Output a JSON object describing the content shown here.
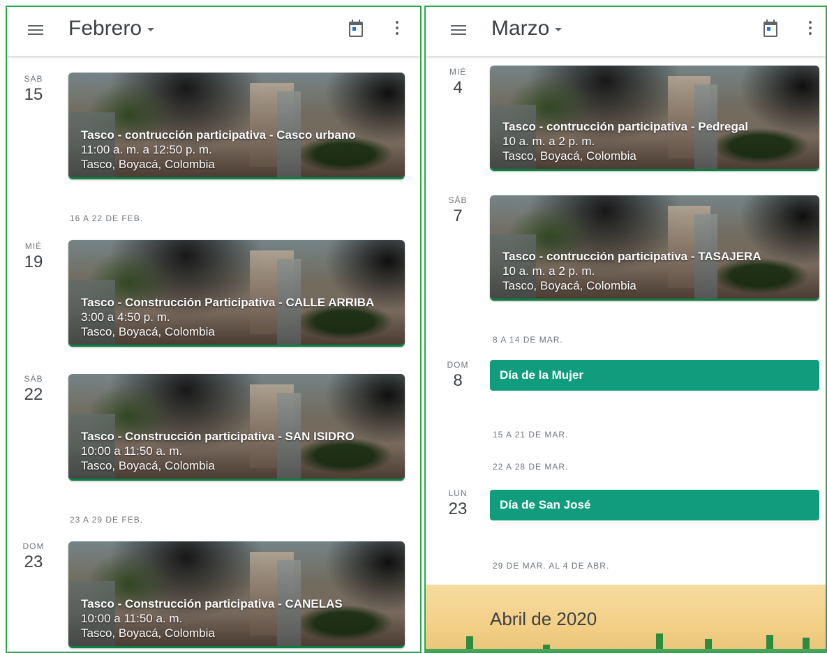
{
  "left": {
    "header": {
      "title": "Febrero"
    },
    "days": [
      {
        "name": "SÁB",
        "num": "15"
      },
      {
        "name": "MIÉ",
        "num": "19"
      },
      {
        "name": "SÁB",
        "num": "22"
      },
      {
        "name": "DOM",
        "num": "23"
      }
    ],
    "weeks": [
      "16 A 22 DE FEB.",
      "23 A 29 DE FEB."
    ],
    "events": [
      {
        "title": "Tasco - contrucción participativa - Casco urbano",
        "time": "11:00 a. m. a 12:50 p. m.",
        "place": "Tasco, Boyacá, Colombia"
      },
      {
        "title": "Tasco - Construcción Participativa - CALLE ARRIBA",
        "time": "3:00 a 4:50 p. m.",
        "place": "Tasco, Boyacá, Colombia"
      },
      {
        "title": "Tasco - Construcción participativa - SAN ISIDRO",
        "time": "10:00 a 11:50 a. m.",
        "place": "Tasco, Boyacá, Colombia"
      },
      {
        "title": "Tasco - Construcción participativa - CANELAS",
        "time": "10:00 a 11:50 a. m.",
        "place": "Tasco, Boyacá, Colombia"
      }
    ]
  },
  "right": {
    "header": {
      "title": "Marzo"
    },
    "days": [
      {
        "name": "MIÉ",
        "num": "4"
      },
      {
        "name": "SÁB",
        "num": "7"
      },
      {
        "name": "DOM",
        "num": "8"
      },
      {
        "name": "LUN",
        "num": "23"
      }
    ],
    "weeks": [
      "8 A 14 DE MAR.",
      "15 A 21 DE MAR.",
      "22 A 28 DE MAR.",
      "29 DE MAR. AL 4 DE ABR."
    ],
    "events": [
      {
        "title": "Tasco - contrucción participativa - Pedregal",
        "time": "10 a. m. a 2 p. m.",
        "place": "Tasco, Boyacá, Colombia"
      },
      {
        "title": "Tasco - contrucción participativa - TASAJERA",
        "time": "10 a. m. a 2 p. m.",
        "place": "Tasco, Boyacá, Colombia"
      }
    ],
    "holidays": [
      "Día de la Mujer",
      "Día de San José"
    ],
    "banner": {
      "title": "Abril de 2020"
    }
  },
  "colors": {
    "accent_green": "#0f9d7d",
    "event_border": "#0b8043",
    "today_blue": "#1a73e8",
    "panel_frame": "#29a847"
  },
  "icons": {
    "menu": "menu-icon",
    "calendar": "calendar-today-icon",
    "more": "more-vert-icon",
    "dropdown": "dropdown-arrow-icon"
  }
}
